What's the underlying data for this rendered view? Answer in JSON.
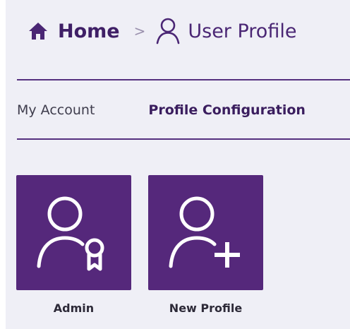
{
  "breadcrumb": {
    "home_label": "Home",
    "separator": ">",
    "current_label": "User Profile",
    "home_icon": "home-icon",
    "current_icon": "user-icon"
  },
  "tabs": [
    {
      "label": "My Account",
      "active": false
    },
    {
      "label": "Profile Configuration",
      "active": true
    }
  ],
  "tiles": [
    {
      "label": "Admin",
      "icon": "user-badge-icon"
    },
    {
      "label": "New Profile",
      "icon": "user-add-icon"
    }
  ],
  "colors": {
    "accent": "#55287b",
    "heading": "#3f1f66",
    "background": "#efeff6",
    "divider": "#55307f"
  }
}
